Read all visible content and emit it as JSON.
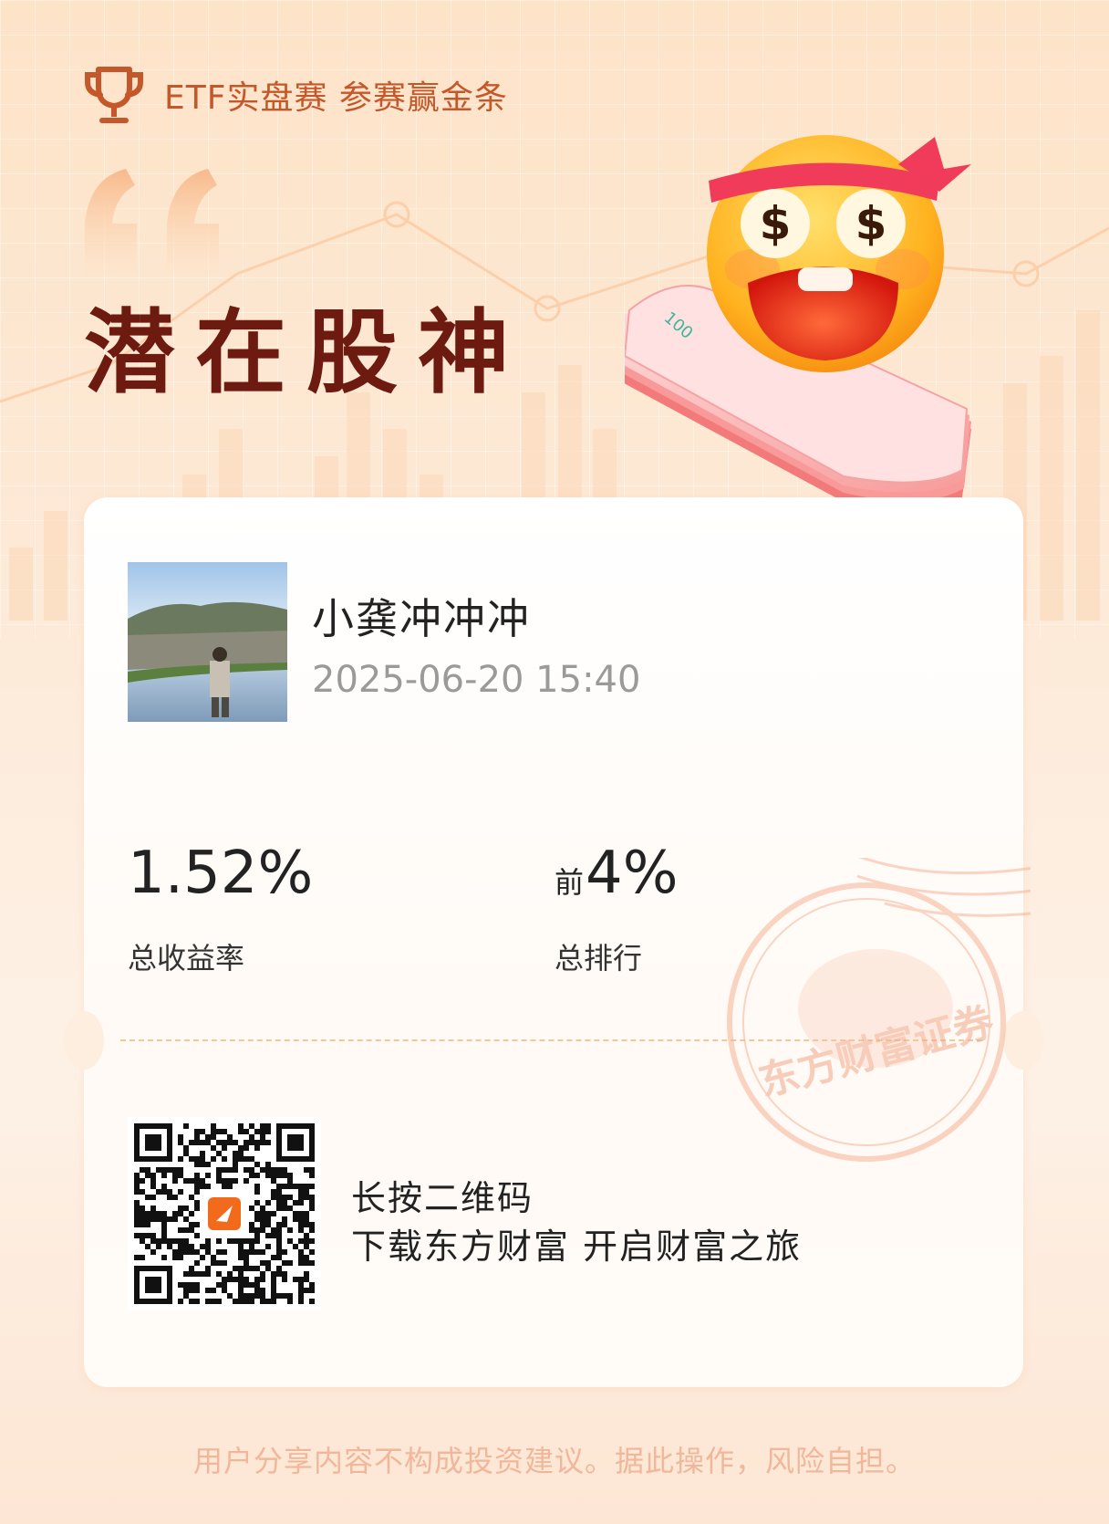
{
  "header": {
    "text": "ETF实盘赛 参赛赢金条",
    "icon": "trophy-icon"
  },
  "title": "潜在股神",
  "user": {
    "name": "小龚冲冲冲",
    "datetime": "2025-06-20 15:40"
  },
  "stats": {
    "return_value": "1.52%",
    "return_label": "总收益率",
    "rank_prefix": "前",
    "rank_value": "4%",
    "rank_label": "总排行"
  },
  "stamp": {
    "text": "东方财富证券"
  },
  "emoji": {
    "eye_symbol": "$",
    "banknote_label": "100"
  },
  "cta": {
    "line1": "长按二维码",
    "line2": "下载东方财富 开启财富之旅"
  },
  "disclaimer": "用户分享内容不构成投资建议。据此操作，风险自担。",
  "colors": {
    "accent": "#c4582a",
    "title": "#6d1a10",
    "disclaimer": "#f0b79a"
  }
}
